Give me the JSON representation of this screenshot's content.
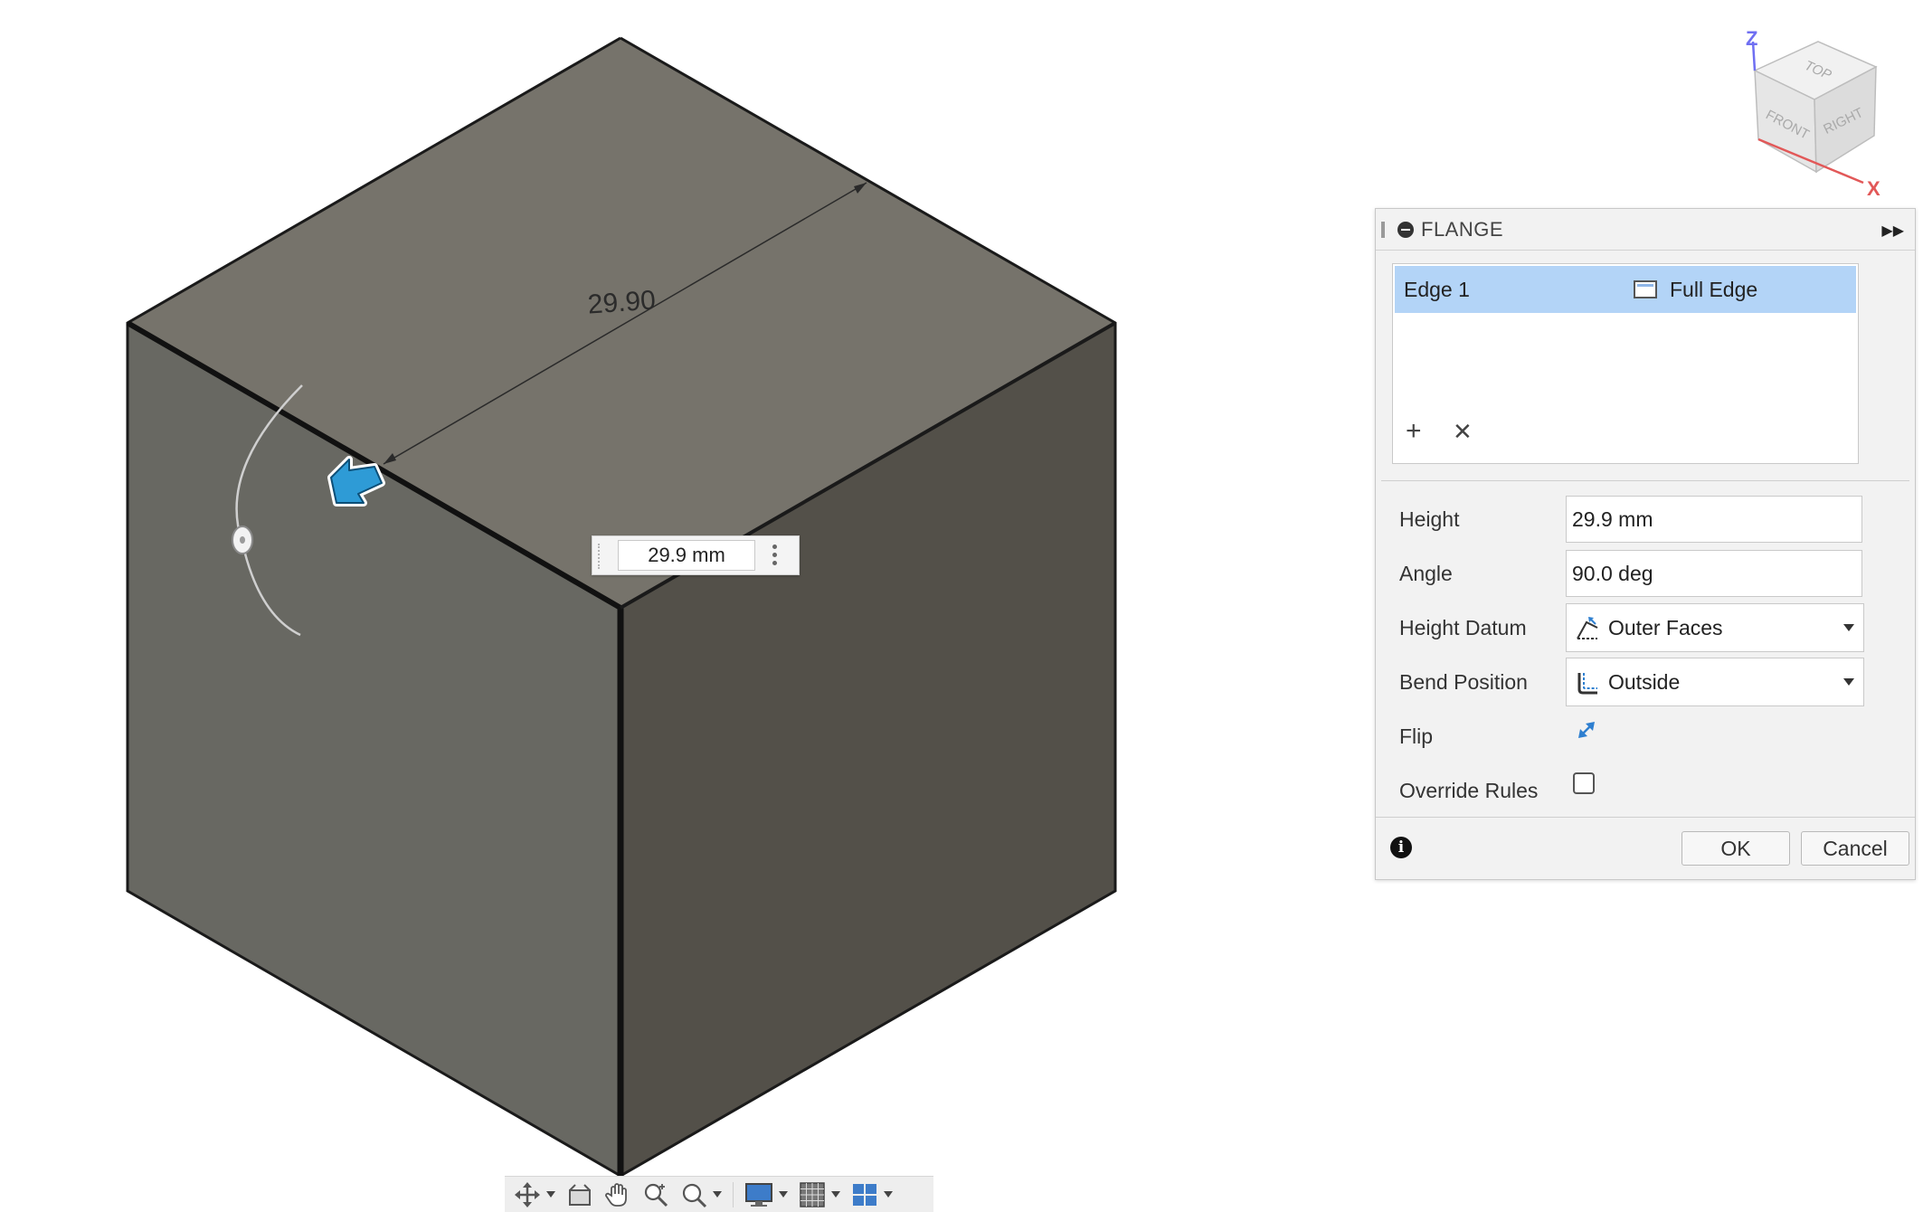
{
  "canvas": {
    "dimension_label": "29.90",
    "dimension_input_value": "29.9 mm",
    "colors": {
      "top_face": "#76736b",
      "left_face": "#686862",
      "right_face": "#535049",
      "manipulator_arrow": "#2e9bd6"
    }
  },
  "viewcube": {
    "faces": {
      "top": "TOP",
      "front": "FRONT",
      "right": "RIGHT"
    },
    "axes": {
      "z": "Z",
      "x": "X"
    }
  },
  "nav_toolbar": {
    "tools": [
      "orbit-icon",
      "look-at-icon",
      "pan-icon",
      "zoom-icon",
      "fit-icon",
      "display-settings-icon",
      "grid-icon",
      "viewports-icon"
    ]
  },
  "flange": {
    "title": "FLANGE",
    "selection": {
      "name": "Edge 1",
      "extent": "Full Edge"
    },
    "height": {
      "label": "Height",
      "value": "29.9 mm"
    },
    "angle": {
      "label": "Angle",
      "value": "90.0 deg"
    },
    "height_datum": {
      "label": "Height Datum",
      "value": "Outer Faces"
    },
    "bend_position": {
      "label": "Bend Position",
      "value": "Outside"
    },
    "flip": {
      "label": "Flip"
    },
    "override_rules": {
      "label": "Override Rules",
      "checked": false
    },
    "ok_label": "OK",
    "cancel_label": "Cancel"
  }
}
